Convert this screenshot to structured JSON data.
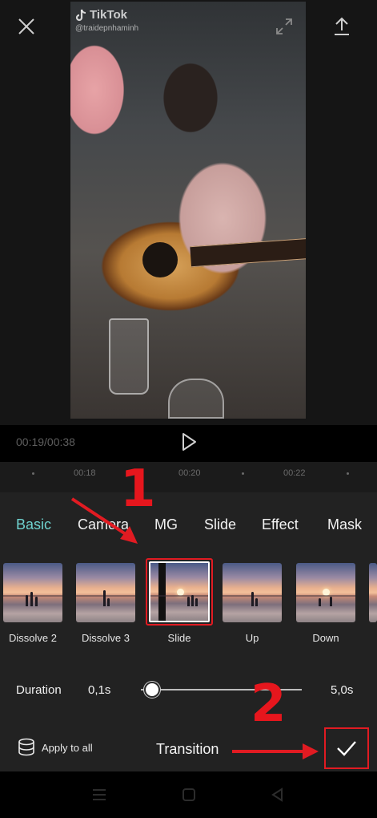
{
  "preview": {
    "watermark_brand": "TikTok",
    "watermark_handle": "@traidepnhaminh"
  },
  "icons": {
    "close": "close-icon",
    "fullscreen": "fullscreen-icon",
    "export": "export-icon",
    "play": "play-icon",
    "layers": "layers-icon",
    "check": "check-icon"
  },
  "playback": {
    "timecode": "00:19/00:38"
  },
  "ruler": {
    "labels": [
      "00:18",
      "00:20",
      "00:22"
    ]
  },
  "tabs": [
    {
      "label": "Basic",
      "active": true
    },
    {
      "label": "Camera",
      "active": false
    },
    {
      "label": "MG",
      "active": false
    },
    {
      "label": "Slide",
      "active": false
    },
    {
      "label": "Effect",
      "active": false
    },
    {
      "label": "Mask",
      "active": false
    }
  ],
  "transitions": [
    {
      "label": "Dissolve 2",
      "selected": false
    },
    {
      "label": "Dissolve 3",
      "selected": false
    },
    {
      "label": "Slide",
      "selected": true
    },
    {
      "label": "Up",
      "selected": false
    },
    {
      "label": "Down",
      "selected": false
    }
  ],
  "duration": {
    "label": "Duration",
    "min": "0,1s",
    "max": "5,0s",
    "value_fraction": 0.0
  },
  "footer": {
    "apply_all": "Apply to all",
    "title": "Transition"
  },
  "annotations": {
    "step1": "1",
    "step2": "2"
  },
  "colors": {
    "accent": "#6fd2cf",
    "annotation_red": "#e11b22",
    "panel_bg": "#222222"
  }
}
